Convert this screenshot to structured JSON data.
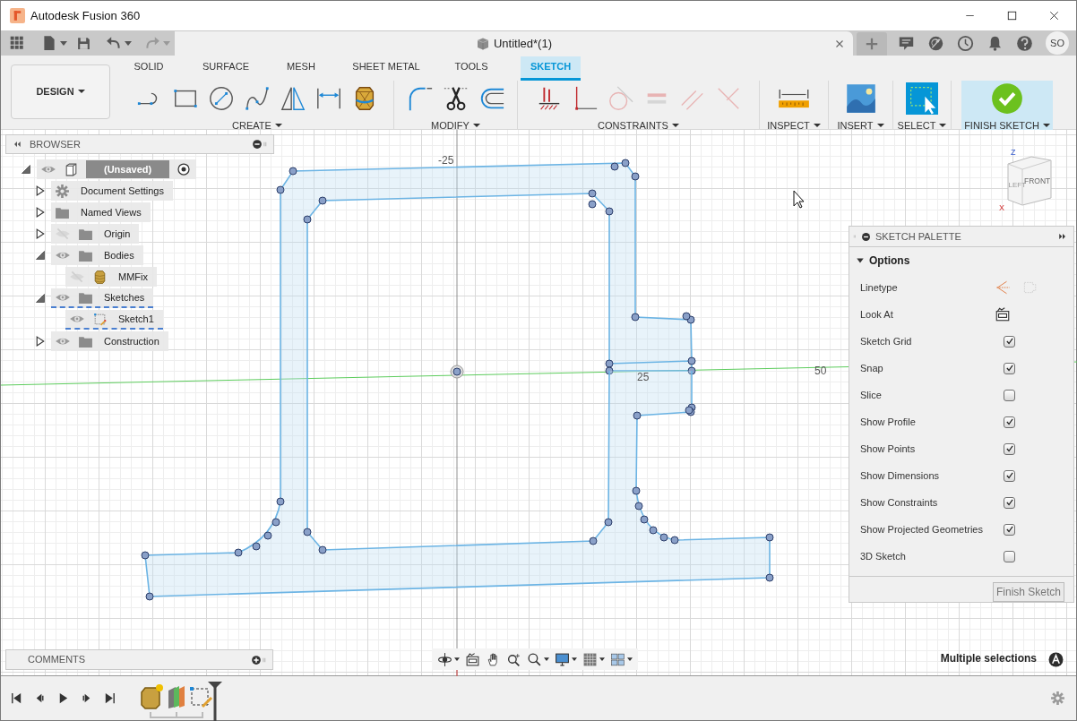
{
  "window": {
    "title": "Autodesk Fusion 360"
  },
  "document_tab": {
    "title": "Untitled*(1)"
  },
  "user": {
    "initials": "SO"
  },
  "ribbon": {
    "workspace": "DESIGN",
    "tabs": [
      {
        "label": "SOLID",
        "selected": false
      },
      {
        "label": "SURFACE",
        "selected": false
      },
      {
        "label": "MESH",
        "selected": false
      },
      {
        "label": "SHEET METAL",
        "selected": false
      },
      {
        "label": "TOOLS",
        "selected": false
      },
      {
        "label": "SKETCH",
        "selected": true
      }
    ],
    "groups": [
      {
        "label": "CREATE",
        "kind": "tools"
      },
      {
        "label": "MODIFY",
        "kind": "tools"
      },
      {
        "label": "CONSTRAINTS",
        "kind": "tools"
      },
      {
        "label": "INSPECT",
        "kind": "tools"
      },
      {
        "label": "INSERT",
        "kind": "tools"
      },
      {
        "label": "SELECT",
        "kind": "tools"
      },
      {
        "label": "FINISH SKETCH",
        "kind": "finish"
      }
    ]
  },
  "browser": {
    "title": "BROWSER",
    "tree": [
      {
        "label": "(Unsaved)",
        "kind": "component",
        "visible": true,
        "expanded": true,
        "active": false,
        "children": [
          {
            "label": "Document Settings",
            "kind": "settings",
            "expanded": false,
            "active": false
          },
          {
            "label": "Named Views",
            "kind": "folder",
            "expanded": false,
            "active": false
          },
          {
            "label": "Origin",
            "kind": "folder",
            "visible": false,
            "expanded": false,
            "active": false
          },
          {
            "label": "Bodies",
            "kind": "folder",
            "visible": true,
            "expanded": true,
            "active": false,
            "children": [
              {
                "label": "MMFix",
                "kind": "body",
                "visible": false,
                "active": false
              }
            ]
          },
          {
            "label": "Sketches",
            "kind": "folder",
            "visible": true,
            "expanded": true,
            "active": true,
            "children": [
              {
                "label": "Sketch1",
                "kind": "sketch",
                "visible": true,
                "active": true
              }
            ]
          },
          {
            "label": "Construction",
            "kind": "folder",
            "visible": true,
            "expanded": false,
            "active": false
          }
        ]
      }
    ]
  },
  "canvas": {
    "dimension_labels": [
      "-25",
      "25",
      "50"
    ]
  },
  "view_cube": {
    "front": "FRONT",
    "left": "LEFT",
    "axes": [
      "Z",
      "X"
    ]
  },
  "sketch_palette": {
    "title": "SKETCH PALETTE",
    "section": "Options",
    "options": [
      {
        "label": "Linetype",
        "kind": "linetype"
      },
      {
        "label": "Look At",
        "kind": "look_at"
      },
      {
        "label": "Sketch Grid",
        "kind": "checkbox",
        "checked": true
      },
      {
        "label": "Snap",
        "kind": "checkbox",
        "checked": true
      },
      {
        "label": "Slice",
        "kind": "checkbox",
        "checked": false
      },
      {
        "label": "Show Profile",
        "kind": "checkbox",
        "checked": true
      },
      {
        "label": "Show Points",
        "kind": "checkbox",
        "checked": true
      },
      {
        "label": "Show Dimensions",
        "kind": "checkbox",
        "checked": true
      },
      {
        "label": "Show Constraints",
        "kind": "checkbox",
        "checked": true
      },
      {
        "label": "Show Projected Geometries",
        "kind": "checkbox",
        "checked": true
      },
      {
        "label": "3D Sketch",
        "kind": "checkbox",
        "checked": false
      }
    ],
    "button": "Finish Sketch"
  },
  "comments": {
    "title": "COMMENTS"
  },
  "status": "Multiple selections"
}
